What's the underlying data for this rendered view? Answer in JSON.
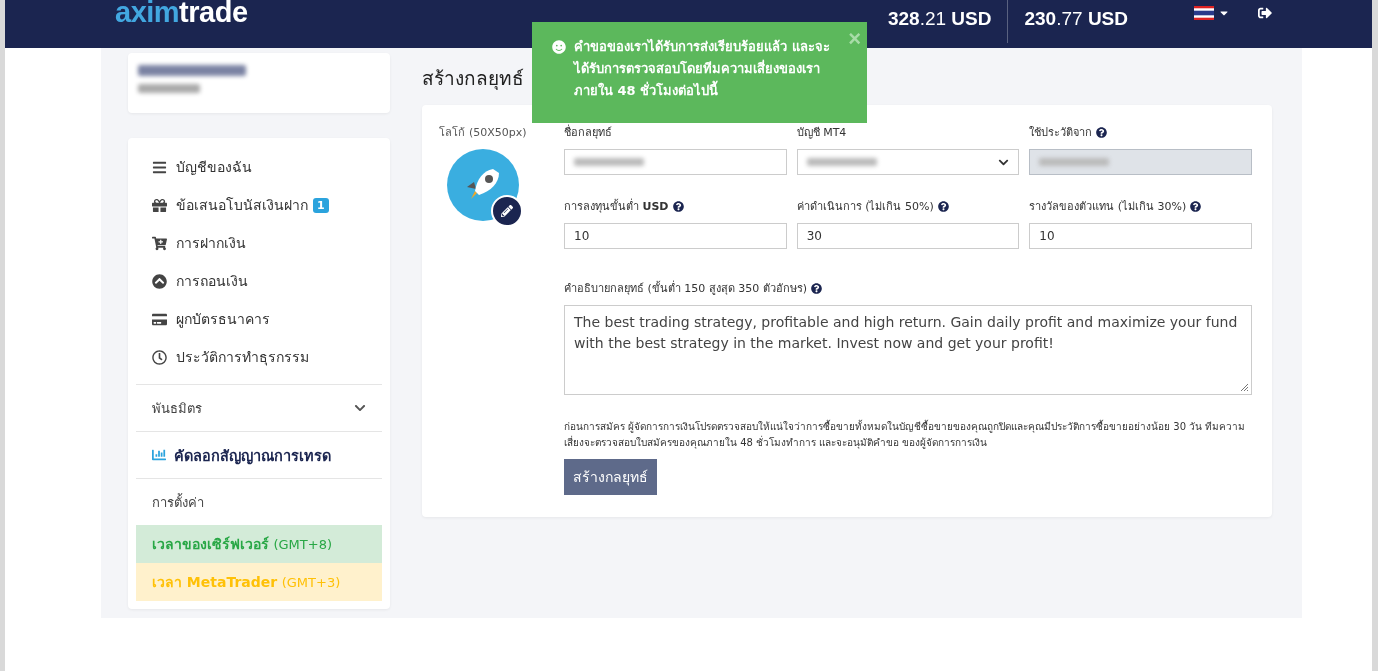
{
  "header": {
    "logo": {
      "first": "axim",
      "second": "trade"
    },
    "balances": [
      {
        "whole": "328",
        "fraction": ".21",
        "currency": "USD"
      },
      {
        "whole": "230",
        "fraction": ".77",
        "currency": "USD"
      }
    ]
  },
  "toast": {
    "message": "คำขอของเราได้รับการส่งเรียบร้อยแล้ว และจะได้รับการตรวจสอบโดยทีมความเสี่ยงของเราภายใน 48 ชั่วโมงต่อไปนี้",
    "close": "×"
  },
  "sidebar": {
    "items": [
      {
        "label": "บัญชีของฉัน"
      },
      {
        "label": "ข้อเสนอโบนัสเงินฝาก",
        "badge": "1"
      },
      {
        "label": "การฝากเงิน"
      },
      {
        "label": "การถอนเงิน"
      },
      {
        "label": "ผูกบัตรธนาคาร"
      },
      {
        "label": "ประวัติการทำธุรกรรม"
      }
    ],
    "sections": [
      {
        "kind": "group",
        "label": "พันธมิตร",
        "expanded": false,
        "selected": false
      },
      {
        "kind": "link",
        "label": "คัดลอกสัญญาณการเทรด",
        "selected": true
      },
      {
        "kind": "plain",
        "label": "การตั้งค่า",
        "selected": false
      }
    ],
    "clocks": [
      {
        "label": "เวลาของเซิร์ฟเวอร์",
        "offset": "(GMT+8)",
        "color": "#28a745"
      },
      {
        "label": "เวลา MetaTrader",
        "offset": "(GMT+3)",
        "color": "#ffc107"
      }
    ]
  },
  "form": {
    "title": "สร้างกลยุทธ์",
    "logo_label": "โลโก้ (50X50px)",
    "fields": [
      {
        "kind": "text",
        "label": "ชื่อกลยุทธ์",
        "help": false,
        "redacted": true,
        "disabled": false
      },
      {
        "kind": "select",
        "label": "บัญชี MT4",
        "help": false,
        "redacted": true,
        "disabled": false
      },
      {
        "kind": "text",
        "label": "ใช้ประวัติจาก",
        "help": true,
        "redacted": true,
        "disabled": true
      },
      {
        "kind": "text",
        "label": "การลงทุนขั้นต่ำ **USD**",
        "help": true,
        "redacted": false,
        "disabled": false,
        "value": "10"
      },
      {
        "kind": "text",
        "label": "ค่าดำเนินการ (ไม่เกิน 50%)",
        "help": true,
        "redacted": false,
        "disabled": false,
        "value": "30"
      },
      {
        "kind": "text",
        "label": "รางวัลของตัวแทน (ไม่เกิน 30%)",
        "help": true,
        "redacted": false,
        "disabled": false,
        "value": "10"
      }
    ],
    "description": {
      "label": "คำอธิบายกลยุทธ์ (ขั้นต่ำ 150 สูงสุด 350 ตัวอักษร)",
      "help": true,
      "value": "The best trading strategy, profitable and high return. Gain daily profit and maximize your fund with the best strategy in the market. Invest now and get your profit!"
    },
    "notice": "ก่อนการสมัคร ผู้จัดการการเงินโปรดตรวจสอบให้แน่ใจว่าการซื้อขายทั้งหมดในบัญชีซื้อขายของคุณถูกปิดและคุณมีประวัติการซื้อขายอย่างน้อย 30 วัน ทีมความเสี่ยงจะตรวจสอบใบสมัครของคุณภายใน 48 ชั่วโมงทำการ และจะอนุมัติคำขอ ของผู้จัดการการเงิน",
    "submit": "สร้างกลยุทธ์"
  }
}
